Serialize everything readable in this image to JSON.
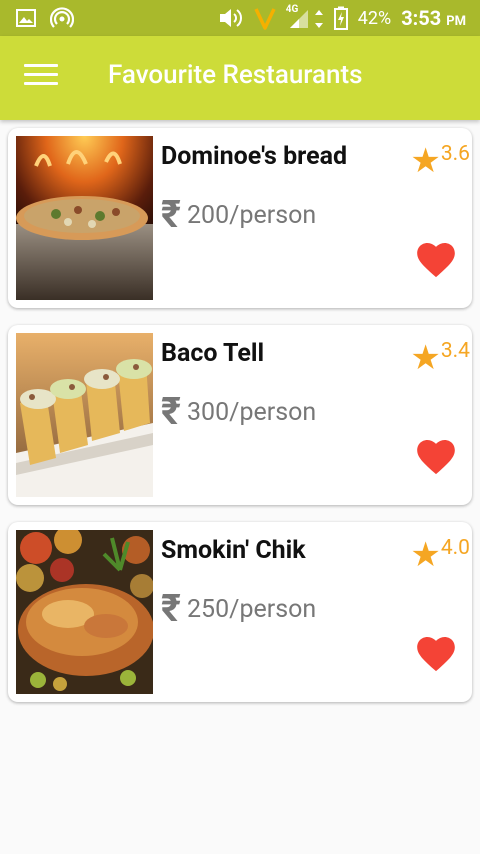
{
  "status_bar": {
    "network": "4G",
    "battery": "42%",
    "time": "3:53",
    "ampm": "PM"
  },
  "app_bar": {
    "title": "Favourite Restaurants",
    "menu_icon": "hamburger-menu-icon"
  },
  "colors": {
    "status_bar": "#a9b92c",
    "app_bar": "#cddc39",
    "rating": "#f5a623",
    "heart": "#f44336"
  },
  "restaurants": [
    {
      "name": "Dominoe's bread",
      "rating": "3.6",
      "currency_symbol": "₹",
      "price": "200/person",
      "image": "pizza",
      "favourite": true
    },
    {
      "name": "Baco Tell",
      "rating": "3.4",
      "currency_symbol": "₹",
      "price": "300/person",
      "image": "tacos",
      "favourite": true
    },
    {
      "name": "Smokin' Chik",
      "rating": "4.0",
      "currency_symbol": "₹",
      "price": "250/person",
      "image": "roast-chicken",
      "favourite": true
    }
  ]
}
